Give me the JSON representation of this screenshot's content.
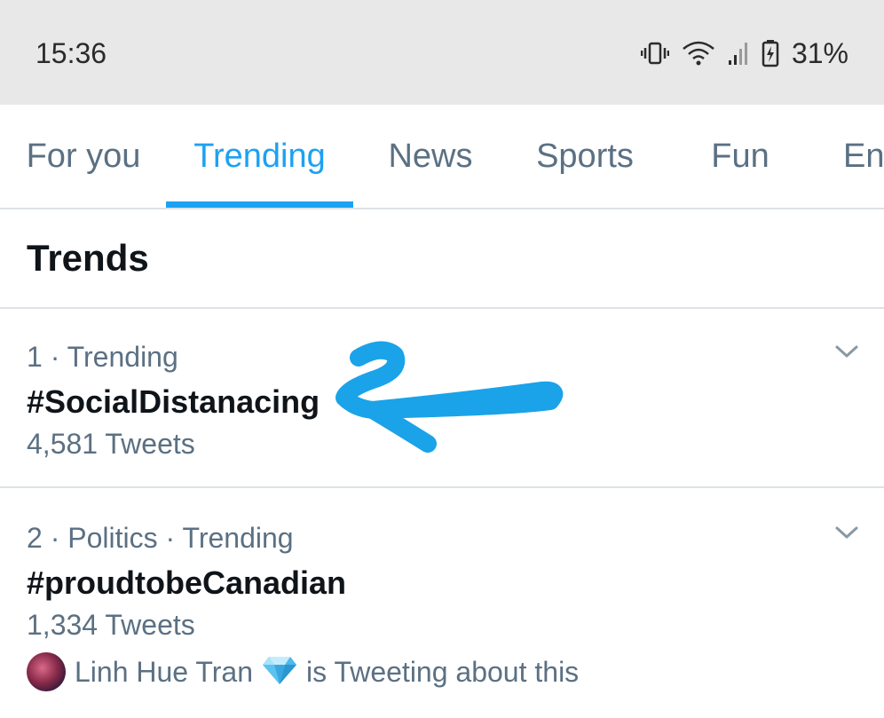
{
  "status_bar": {
    "time": "15:36",
    "battery": "31%",
    "icons": [
      "vibrate-icon",
      "wifi-icon",
      "signal-icon",
      "battery-charging-icon"
    ]
  },
  "tabs": [
    {
      "label": "For you",
      "active": false
    },
    {
      "label": "Trending",
      "active": true
    },
    {
      "label": "News",
      "active": false
    },
    {
      "label": "Sports",
      "active": false
    },
    {
      "label": "Fun",
      "active": false
    },
    {
      "label": "Ent",
      "active": false
    }
  ],
  "section_title": "Trends",
  "trends": [
    {
      "meta": "1 · Trending",
      "name": "#SocialDistanacing",
      "count": "4,581 Tweets"
    },
    {
      "meta": "2 · Politics · Trending",
      "name": "#proudtobeCanadian",
      "count": "1,334 Tweets",
      "social_context": {
        "user": "Linh Hue Tran",
        "badge_icon": "gem-emoji-icon",
        "suffix": "is Tweeting about this"
      }
    }
  ],
  "colors": {
    "accent": "#1da1f2",
    "secondary_text": "#5b7083",
    "primary_text": "#0f1419",
    "status_bar_bg": "#e8e8e8",
    "annotation": "#1aa3e8"
  }
}
